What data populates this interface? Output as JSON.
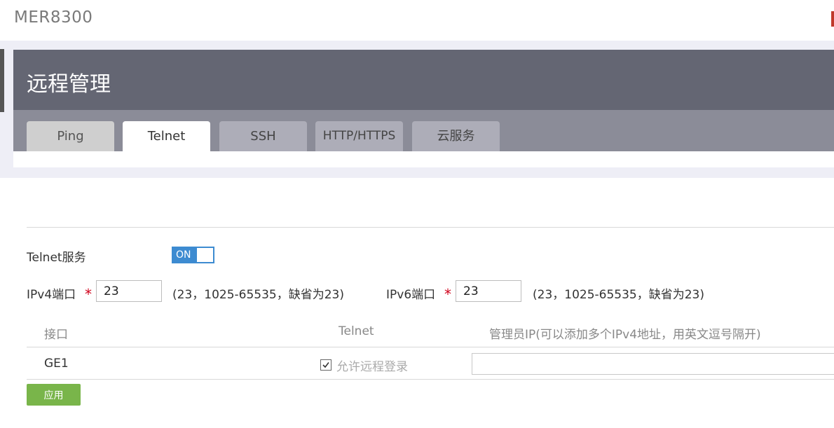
{
  "app": {
    "brand": "MER8300"
  },
  "page": {
    "title": "远程管理"
  },
  "tabs": [
    {
      "label": "Ping"
    },
    {
      "label": "Telnet",
      "active": true
    },
    {
      "label": "SSH"
    },
    {
      "label": "HTTP/HTTPS"
    },
    {
      "label": "云服务"
    }
  ],
  "service": {
    "label": "Telnet服务",
    "toggle_label": "ON",
    "enabled": true
  },
  "ipv4": {
    "label": "IPv4端口",
    "required_mark": "*",
    "value": "23",
    "hint": "(23，1025-65535，缺省为23)"
  },
  "ipv6": {
    "label": "IPv6端口",
    "required_mark": "*",
    "value": "23",
    "hint": "(23，1025-65535，缺省为23)"
  },
  "table": {
    "headers": {
      "interface": "接口",
      "telnet": "Telnet",
      "admin_ip": "管理员IP(可以添加多个IPv4地址，用英文逗号隔开)"
    },
    "rows": [
      {
        "interface": "GE1",
        "allow_checked": true,
        "allow_label": "允许远程登录",
        "admin_ip": ""
      }
    ]
  },
  "actions": {
    "apply_label": "应用"
  },
  "colors": {
    "header": "#646673",
    "tabbar": "#8b8c98",
    "accent": "#3d8bd1",
    "apply": "#79b54a",
    "required": "#d0021b"
  }
}
